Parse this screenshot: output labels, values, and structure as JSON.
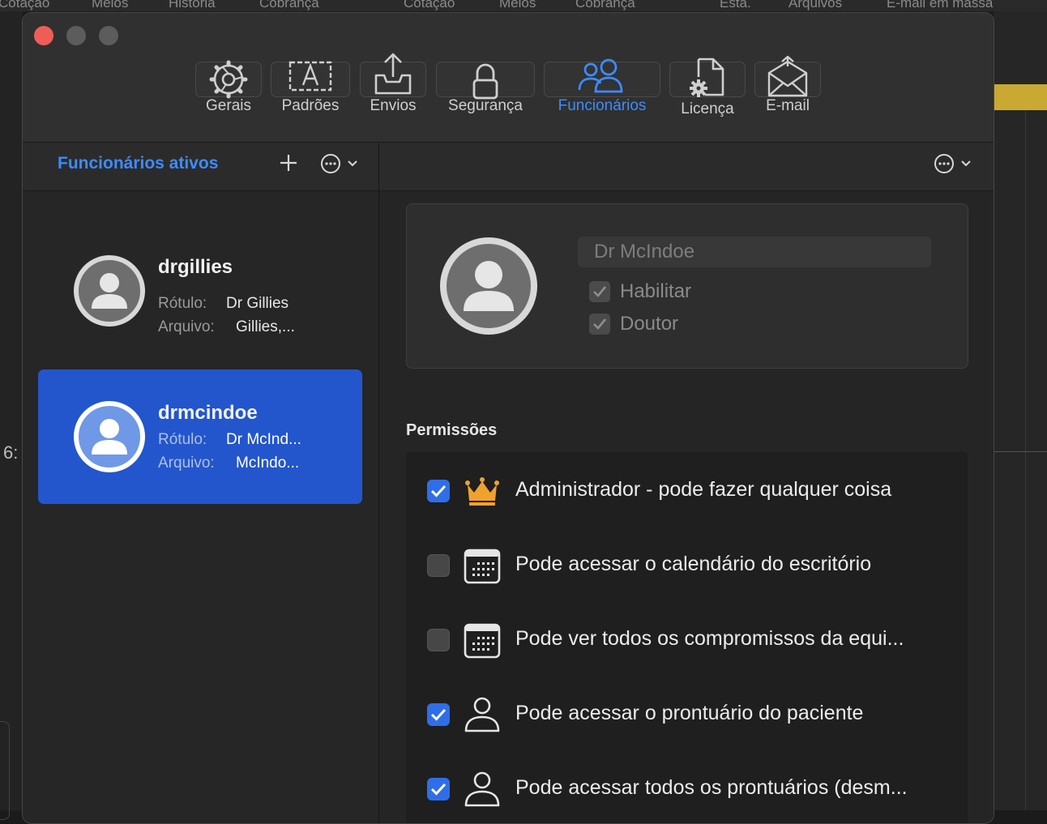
{
  "background_tabs": [
    "Cotação",
    "Meios",
    "História",
    "Cobrança",
    "Cotação",
    "Meios",
    "Cobrança",
    "Esta.",
    "Arquivos",
    "E-mail em massa"
  ],
  "background_fragment": "6:",
  "toolbar": {
    "tabs": [
      {
        "label": "Gerais",
        "icon": "gear-icon"
      },
      {
        "label": "Padrões",
        "icon": "text-template-icon"
      },
      {
        "label": "Envios",
        "icon": "upload-tray-icon"
      },
      {
        "label": "Segurança",
        "icon": "lock-icon"
      },
      {
        "label": "Funcionários",
        "icon": "people-icon",
        "active": true
      },
      {
        "label": "Licença",
        "icon": "license-document-icon"
      },
      {
        "label": "E-mail",
        "icon": "envelope-icon"
      }
    ]
  },
  "sidebar": {
    "title": "Funcionários ativos",
    "users": [
      {
        "username": "drgillies",
        "label_caption": "Rótulo:",
        "label_value": "Dr Gillies",
        "file_caption": "Arquivo:",
        "file_value": "Gillies,...",
        "selected": false
      },
      {
        "username": "drmcindoe",
        "label_caption": "Rótulo:",
        "label_value": "Dr McInd...",
        "file_caption": "Arquivo:",
        "file_value": "McIndo...",
        "selected": true
      }
    ]
  },
  "detail": {
    "name_value": "Dr McIndoe",
    "enable_label": "Habilitar",
    "doctor_label": "Doutor",
    "permissions_title": "Permissões",
    "permissions": [
      {
        "label": "Administrador - pode fazer qualquer coisa",
        "checked": true,
        "icon": "crown-icon"
      },
      {
        "label": "Pode acessar o calendário do escritório",
        "checked": false,
        "icon": "calendar-icon"
      },
      {
        "label": "Pode ver todos os compromissos da equi...",
        "checked": false,
        "icon": "calendar-icon"
      },
      {
        "label": "Pode acessar o prontuário do paciente",
        "checked": true,
        "icon": "person-icon"
      },
      {
        "label": "Pode acessar todos os prontuários (desm...",
        "checked": true,
        "icon": "person-icon"
      }
    ]
  },
  "colors": {
    "accent": "#3d8bff",
    "selection": "#2356cc",
    "crown": "#f0a22e",
    "close": "#ee5e56"
  }
}
